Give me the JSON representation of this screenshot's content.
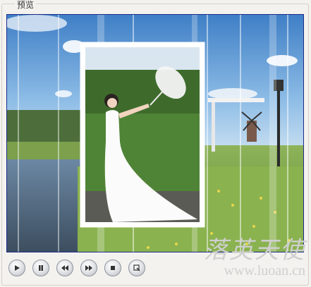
{
  "group": {
    "title": "预览"
  },
  "preview": {
    "description": ""
  },
  "controls": [
    {
      "name": "play-button",
      "icon": "play-icon"
    },
    {
      "name": "pause-button",
      "icon": "pause-icon"
    },
    {
      "name": "rewind-button",
      "icon": "rewind-icon"
    },
    {
      "name": "fast-forward-button",
      "icon": "fast-forward-icon"
    },
    {
      "name": "stop-button",
      "icon": "stop-icon"
    },
    {
      "name": "snapshot-button",
      "icon": "snapshot-icon"
    }
  ],
  "watermark": {
    "chinese": "落英天使",
    "url": "www.luoan.cn"
  },
  "colors": {
    "frame_border": "#1b2c8a",
    "background": "#f3f2ee"
  }
}
